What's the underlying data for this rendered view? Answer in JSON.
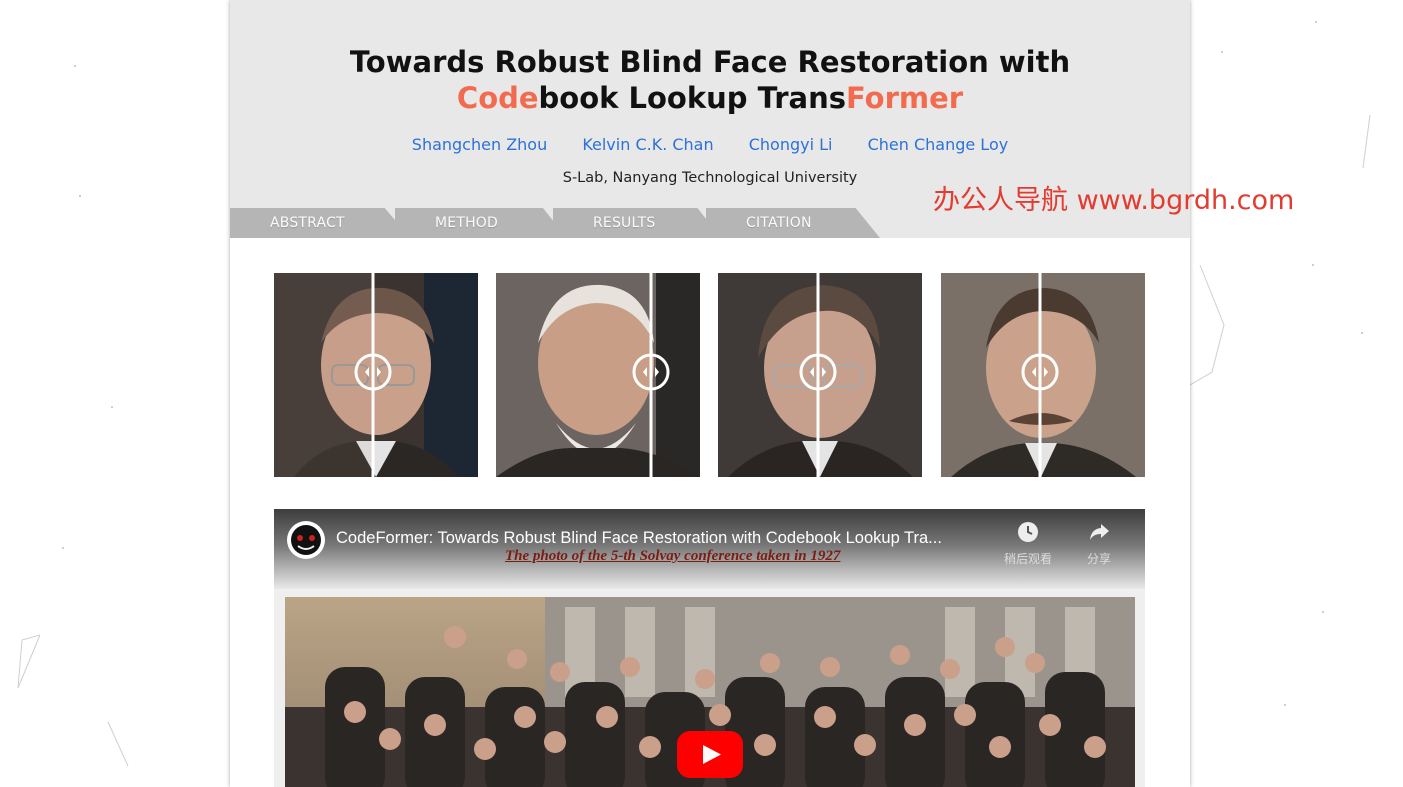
{
  "paper": {
    "title_line1": "Towards Robust Blind Face Restoration with",
    "title_line2_parts": [
      "Code",
      "book Lookup Trans",
      "Former"
    ],
    "authors": [
      "Shangchen Zhou",
      "Kelvin C.K. Chan",
      "Chongyi Li",
      "Chen Change Loy"
    ],
    "affiliation": "S-Lab, Nanyang Technological University"
  },
  "tabs": [
    "ABSTRACT",
    "METHOD",
    "RESULTS",
    "CITATION"
  ],
  "comparisons": [
    {
      "name": "face-comparison-1"
    },
    {
      "name": "face-comparison-2"
    },
    {
      "name": "face-comparison-3"
    },
    {
      "name": "face-comparison-4"
    }
  ],
  "video": {
    "title": "CodeFormer: Towards Robust Blind Face Restoration with Codebook Lookup Tra...",
    "subtitle": "The photo of the 5-th Solvay conference taken in 1927",
    "watch_later": "稍后观看",
    "share": "分享",
    "icons": {
      "watch_later": "clock-icon",
      "share": "share-arrow-icon",
      "play": "play-icon"
    }
  },
  "watermark": "办公人导航  www.bgrdh.com",
  "colors": {
    "accent": "#f26b4f",
    "link": "#2c72d8",
    "header_bg": "#e8e8e8",
    "tab_bg": "#b5b5b5",
    "watermark": "#e43b31",
    "play": "#ff0000"
  }
}
